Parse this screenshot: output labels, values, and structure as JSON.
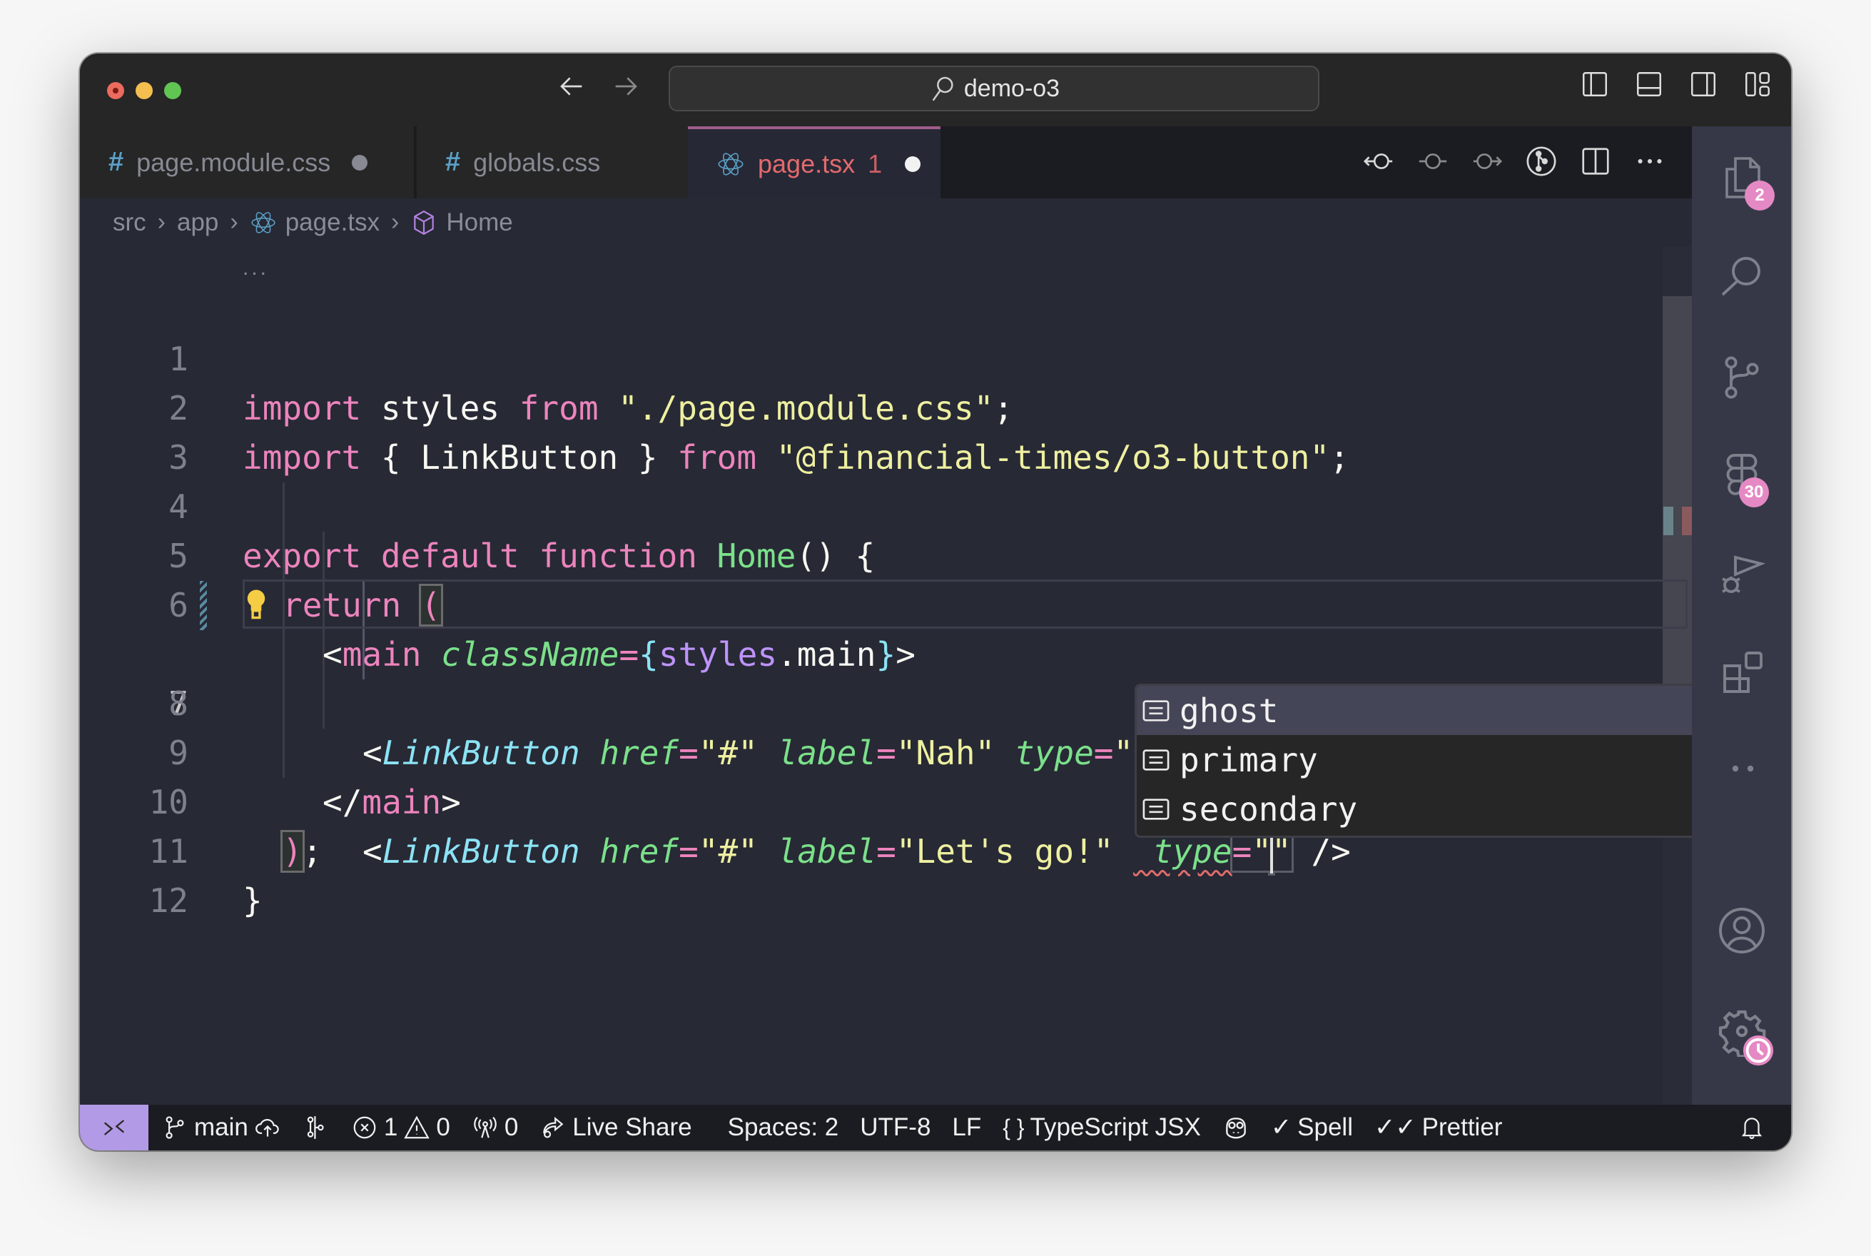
{
  "window": {
    "search_text": "demo-o3"
  },
  "tabs": [
    {
      "label": "page.module.css",
      "icon": "css-hash-icon",
      "modified": true,
      "active": false
    },
    {
      "label": "globals.css",
      "icon": "css-hash-icon",
      "modified": false,
      "active": false
    },
    {
      "label": "page.tsx",
      "problems": "1",
      "icon": "react-icon",
      "modified": true,
      "active": true
    }
  ],
  "breadcrumb": [
    "src",
    "app",
    "page.tsx",
    "Home"
  ],
  "sticky_scroll": "...",
  "code_lines": [
    {
      "n": "1"
    },
    {
      "n": "2"
    },
    {
      "n": "3"
    },
    {
      "n": "4"
    },
    {
      "n": "5"
    },
    {
      "n": "6"
    },
    {
      "n": "7"
    },
    {
      "n": "8"
    },
    {
      "n": "9"
    },
    {
      "n": "10"
    },
    {
      "n": "11"
    },
    {
      "n": "12"
    }
  ],
  "code": {
    "l1": {
      "kw1": "import",
      "id": " styles ",
      "kw2": "from",
      "str": " \"./page.module.css\"",
      "end": ";"
    },
    "l2": {
      "kw1": "import",
      "mid": " { LinkButton } ",
      "kw2": "from",
      "str": " \"@financial-times/o3-button\"",
      "end": ";"
    },
    "l4": {
      "kw": "export default function ",
      "fn": "Home",
      "rest": "() {"
    },
    "l5": {
      "kw": "return ",
      "paren": "("
    },
    "l6": {
      "lt": "<",
      "tag": "main",
      "attr": " className",
      "eq": "=",
      "ob": "{",
      "v1": "styles",
      "dot": ".",
      "v2": "main",
      "cb": "}",
      "gt": ">"
    },
    "l7": {
      "lt": "<",
      "comp": "LinkButton",
      "a1": " href",
      "eq1": "=",
      "s1": "\"#\"",
      "a2": " label",
      "eq2": "=",
      "s2": "\"Let's go!\"",
      "a3": " type",
      "eq3": "=",
      "q1": "\"",
      "q2": "\"",
      "end": " />"
    },
    "l8": {
      "lt": "<",
      "comp": "LinkButton",
      "a1": " href",
      "eq1": "=",
      "s1": "\"#\"",
      "a2": " label",
      "eq2": "=",
      "s2": "\"Nah\"",
      "a3": " type",
      "eq3": "=",
      "q1": "\""
    },
    "l9": {
      "lt": "</",
      "tag": "main",
      "gt": ">"
    },
    "l10": {
      "paren": ")",
      "end": ";"
    },
    "l11": {
      "brace": "}"
    }
  },
  "autocomplete": {
    "items": [
      {
        "label": "ghost",
        "selected": true
      },
      {
        "label": "primary",
        "selected": false
      },
      {
        "label": "secondary",
        "selected": false
      }
    ]
  },
  "activity_bar": {
    "explorer_badge": "2",
    "extensions_badge": "30"
  },
  "status_bar": {
    "branch": "main",
    "errors": "1",
    "warnings": "0",
    "ports": "0",
    "live_share": "Live Share",
    "spaces": "Spaces: 2",
    "encoding": "UTF-8",
    "eol": "LF",
    "language": "TypeScript JSX",
    "spell": "Spell",
    "prettier": "Prettier"
  },
  "colors": {
    "accent_remote": "#b39ae6",
    "badge": "#e589c4",
    "active_tab_text": "#e46a6d"
  }
}
